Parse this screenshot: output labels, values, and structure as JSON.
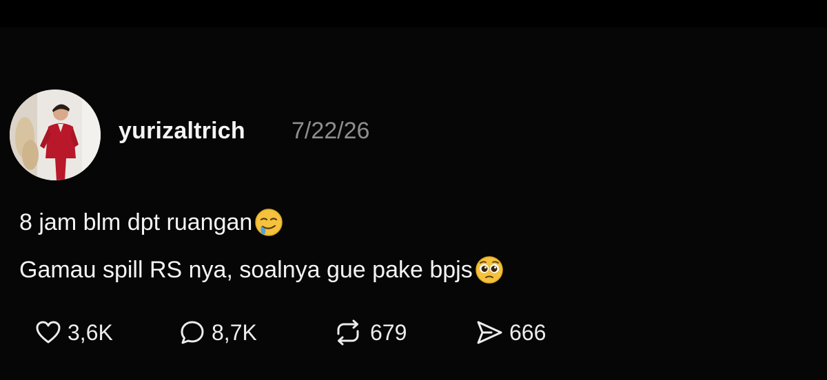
{
  "post": {
    "username": "yurizaltrich",
    "timestamp": "7/22/26",
    "lines": [
      {
        "text": "8 jam blm dpt ruangan",
        "emoji": "drooling-face-emoji"
      },
      {
        "text": "Gamau spill RS nya, soalnya gue pake bpjs",
        "emoji": "pleading-face-emoji"
      }
    ]
  },
  "actions": {
    "like": {
      "icon": "heart-icon",
      "count": "3,6K"
    },
    "reply": {
      "icon": "comment-bubble-icon",
      "count": "8,7K"
    },
    "repost": {
      "icon": "repost-icon",
      "count": "679"
    },
    "share": {
      "icon": "send-icon",
      "count": "666"
    }
  },
  "colors": {
    "background": "#060606",
    "text": "#f4f4f4",
    "muted": "#8e8e8e"
  }
}
